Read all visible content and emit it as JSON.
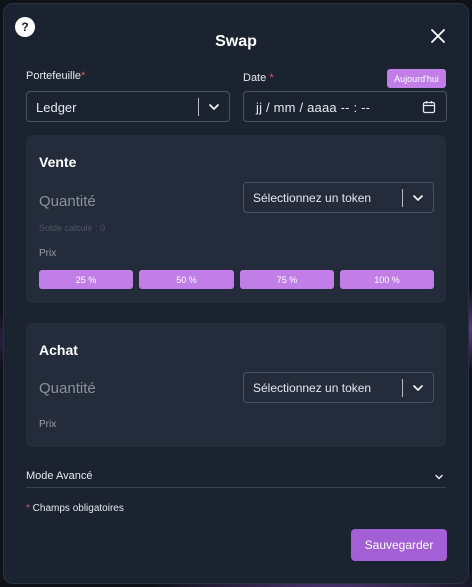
{
  "modal": {
    "title": "Swap",
    "help_label": "?"
  },
  "wallet": {
    "label": "Portefeuille",
    "required_mark": "*",
    "value": "Ledger"
  },
  "date": {
    "label": "Date",
    "required_mark": "*",
    "today_label": "Aujourd'hui",
    "placeholder": "jj / mm / aaaa  -- : --"
  },
  "sell": {
    "title": "Vente",
    "quantity_label": "Quantité",
    "token_select": "Sélectionnez un token",
    "balance_label": "Solde calculé : 0",
    "price_label": "Prix",
    "percent_buttons": [
      "25 %",
      "50 %",
      "75 %",
      "100 %"
    ]
  },
  "buy": {
    "title": "Achat",
    "quantity_label": "Quantité",
    "token_select": "Sélectionnez un token",
    "price_label": "Prix"
  },
  "advanced": {
    "label": "Mode Avancé"
  },
  "footer": {
    "required_mark": "*",
    "required_note": " Champs obligatoires",
    "save_label": "Sauvegarder"
  },
  "colors": {
    "accent": "#c07ee6",
    "save_button": "#a35fd6",
    "required": "#e05a6a",
    "modal_bg": "#1b2230",
    "panel_bg": "#242c3b"
  },
  "icons": {
    "help": "question-icon",
    "close": "close-icon",
    "dropdown": "chevron-down-icon",
    "calendar": "calendar-icon"
  }
}
